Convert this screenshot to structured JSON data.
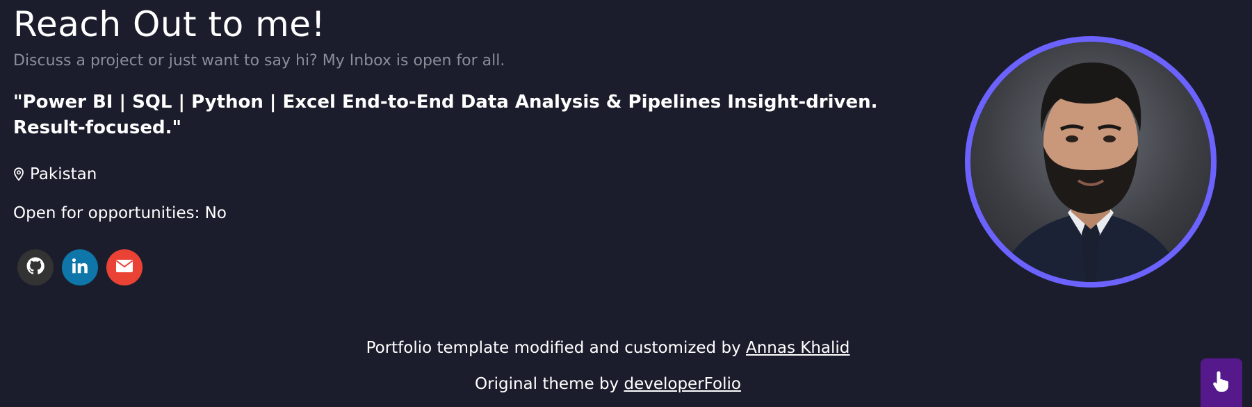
{
  "contact": {
    "title": "Reach Out to me!",
    "subtitle": "Discuss a project or just want to say hi? My Inbox is open for all.",
    "headline": "\"Power BI | SQL | Python | Excel End-to-End Data Analysis & Pipelines Insight-driven. Result-focused.\"",
    "location_icon": "map-pin-icon",
    "location": "Pakistan",
    "opportunities": "Open for opportunities: No"
  },
  "socials": [
    {
      "name": "github",
      "icon": "github-icon",
      "color": "#333333"
    },
    {
      "name": "linkedin",
      "icon": "linkedin-icon",
      "color": "#0e76a8"
    },
    {
      "name": "email",
      "icon": "envelope-icon",
      "color": "#ea4335"
    }
  ],
  "profile": {
    "ring_color": "#6c63ff"
  },
  "footer": {
    "line1_prefix": "Portfolio template modified and customized by ",
    "line1_link": "Annas Khalid",
    "line2_prefix": "Original theme by ",
    "line2_link": "developerFolio"
  },
  "scroll_top": {
    "icon": "pointing-hand-icon",
    "color": "#55198b"
  },
  "theme": {
    "background": "#1b1d2c",
    "subtitle_color": "#8b8d98"
  }
}
